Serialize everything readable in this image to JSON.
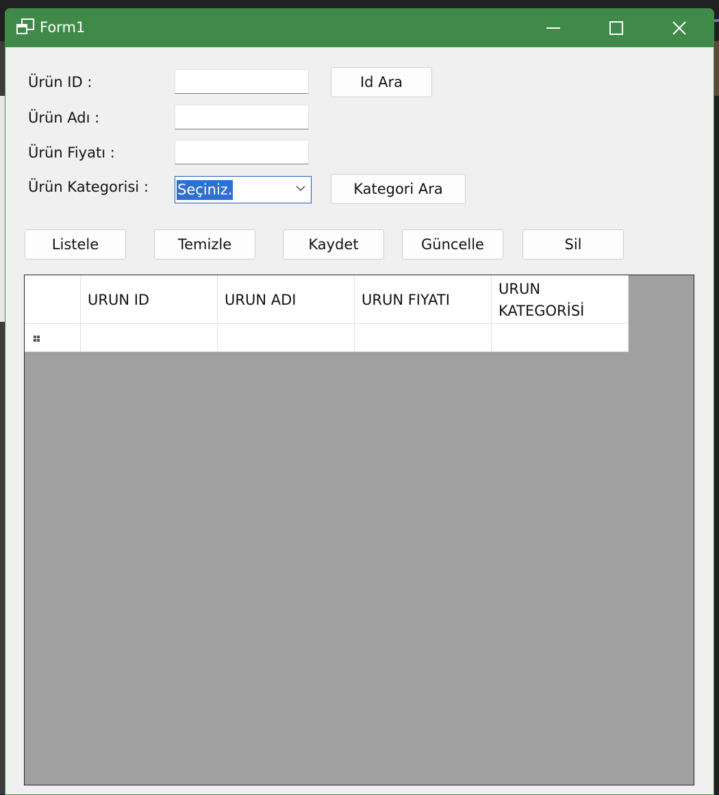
{
  "window": {
    "title": "Form1"
  },
  "form": {
    "id_label": "Ürün ID :",
    "name_label": "Ürün Adı :",
    "price_label": "Ürün Fiyatı :",
    "category_label": "Ürün Kategorisi :",
    "id_value": "",
    "name_value": "",
    "price_value": "",
    "category_selected": "Seçiniz.",
    "id_search_button": "Id Ara",
    "category_search_button": "Kategori Ara"
  },
  "actions": {
    "list": "Listele",
    "clear": "Temizle",
    "save": "Kaydet",
    "update": "Güncelle",
    "delete": "Sil"
  },
  "grid": {
    "columns": [
      "URUN ID",
      "URUN ADI",
      "URUN FIYATI",
      "URUN KATEGORİSİ"
    ],
    "rows": [
      [
        "",
        "",
        "",
        ""
      ]
    ]
  },
  "colors": {
    "titlebar": "#3f8a48",
    "selection": "#2f6fcf",
    "grid_background": "#a0a0a0"
  }
}
